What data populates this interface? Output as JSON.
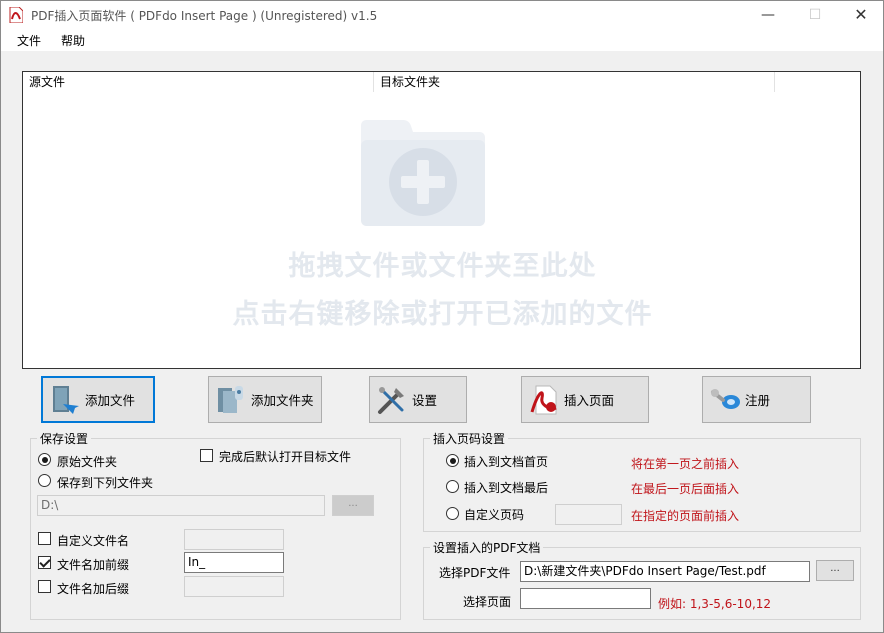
{
  "window": {
    "title": "PDF插入页面软件 ( PDFdo Insert Page ) (Unregistered) v1.5",
    "minimize": "—",
    "maximize": "☐",
    "close": "✕"
  },
  "menu": {
    "file": "文件",
    "help": "帮助"
  },
  "file_list": {
    "columns": [
      "源文件",
      "目标文件夹"
    ],
    "hint_line1": "拖拽文件或文件夹至此处",
    "hint_line2": "点击右键移除或打开已添加的文件"
  },
  "toolbar": {
    "add_file": "添加文件",
    "add_folder": "添加文件夹",
    "settings": "设置",
    "insert_page": "插入页面",
    "register": "注册"
  },
  "save_settings": {
    "title": "保存设置",
    "original_folder": "原始文件夹",
    "save_to_folder": "保存到下列文件夹",
    "open_after": "完成后默认打开目标文件",
    "folder_path": "D:\\",
    "browse": "...",
    "custom_name": "自定义文件名",
    "custom_name_value": "",
    "add_prefix": "文件名加前缀",
    "prefix_value": "In_",
    "add_suffix": "文件名加后缀",
    "suffix_value": "",
    "original_folder_selected": true,
    "open_after_checked": false,
    "custom_name_checked": false,
    "add_prefix_checked": true,
    "add_suffix_checked": false
  },
  "insert_position": {
    "title": "插入页码设置",
    "first": "插入到文档首页",
    "first_note": "将在第一页之前插入",
    "last": "插入到文档最后",
    "last_note": "在最后一页后面插入",
    "custom": "自定义页码",
    "custom_value": "",
    "custom_note": "在指定的页面前插入",
    "selected": "first"
  },
  "insert_doc": {
    "title": "设置插入的PDF文档",
    "select_pdf_label": "选择PDF文件",
    "pdf_path": "D:\\新建文件夹\\PDFdo Insert Page/Test.pdf",
    "browse": "...",
    "select_pages_label": "选择页面",
    "pages_value": "",
    "example": "例如: 1,3-5,6-10,12"
  },
  "colors": {
    "accent": "#0078d7",
    "note_red": "#c0141a",
    "hint_gray": "#e3e8ee"
  },
  "icons": [
    "pdf-app-icon",
    "folder-plus-icon",
    "add-file-icon",
    "add-folder-icon",
    "settings-tools-icon",
    "pdf-insert-icon",
    "key-icon"
  ]
}
